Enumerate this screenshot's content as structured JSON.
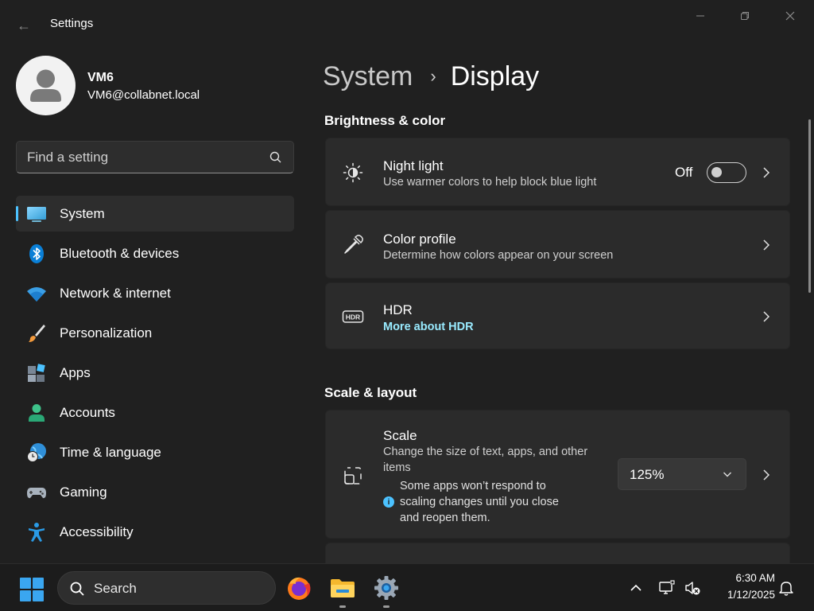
{
  "window": {
    "app_title": "Settings",
    "back_glyph": "←",
    "controls": [
      "minimize-icon",
      "restore-icon",
      "close-icon"
    ]
  },
  "profile": {
    "name": "VM6",
    "email": "VM6@collabnet.local"
  },
  "search": {
    "placeholder": "Find a setting",
    "icon": "search-icon"
  },
  "sidebar": {
    "accent_color": "#4cc2ff",
    "items": [
      {
        "label": "System",
        "icon": "monitor-icon",
        "active": true
      },
      {
        "label": "Bluetooth & devices",
        "icon": "bluetooth-icon",
        "active": false
      },
      {
        "label": "Network & internet",
        "icon": "wifi-icon",
        "active": false
      },
      {
        "label": "Personalization",
        "icon": "brush-icon",
        "active": false
      },
      {
        "label": "Apps",
        "icon": "apps-icon",
        "active": false
      },
      {
        "label": "Accounts",
        "icon": "person-icon",
        "active": false
      },
      {
        "label": "Time & language",
        "icon": "globe-clock-icon",
        "active": false
      },
      {
        "label": "Gaming",
        "icon": "gamepad-icon",
        "active": false
      },
      {
        "label": "Accessibility",
        "icon": "accessibility-icon",
        "active": false
      }
    ]
  },
  "breadcrumb": {
    "parent": "System",
    "separator": "›",
    "current": "Display"
  },
  "sections": {
    "brightness": {
      "title": "Brightness & color",
      "night_light": {
        "title": "Night light",
        "subtitle": "Use warmer colors to help block blue light",
        "toggle_label": "Off",
        "toggle_on": false,
        "icon": "sun-moon-icon"
      },
      "color_profile": {
        "title": "Color profile",
        "subtitle": "Determine how colors appear on your screen",
        "icon": "eyedropper-icon"
      },
      "hdr": {
        "title": "HDR",
        "link": "More about HDR",
        "icon": "hdr-icon",
        "icon_text": "HDR",
        "link_color": "#99ebff"
      }
    },
    "scale_layout": {
      "title": "Scale & layout",
      "scale": {
        "title": "Scale",
        "subtitle_line1": "Change the size of text, apps, and other",
        "subtitle_line2": "items",
        "warning_line1": "Some apps won’t respond to",
        "warning_line2": "scaling changes until you close",
        "warning_line3": "and reopen them.",
        "info_glyph": "i",
        "selected": "125%",
        "icon": "scale-icon"
      }
    }
  },
  "taskbar": {
    "search_label": "Search",
    "apps": [
      "firefox-icon",
      "file-explorer-icon",
      "settings-gear-icon"
    ],
    "tray": [
      "chevron-up-icon",
      "network-icon",
      "volume-muted-icon",
      "notification-bell-icon"
    ],
    "time": "6:30 AM",
    "date": "1/12/2025"
  }
}
